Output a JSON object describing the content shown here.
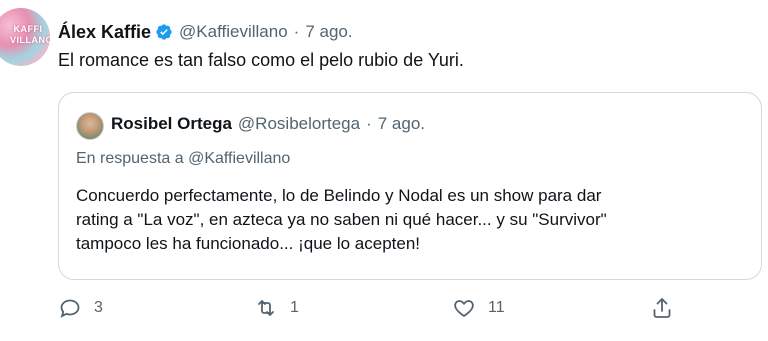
{
  "author": {
    "name": "Álex Kaffie",
    "handle": "@Kaffievillano",
    "separator": "·",
    "date": "7 ago.",
    "avatar_text": "KAFFI VILLANO"
  },
  "tweet": {
    "text": "El romance es tan falso como el pelo rubio de Yuri."
  },
  "quoted": {
    "name": "Rosibel Ortega",
    "handle": "@Rosibelortega",
    "separator": "·",
    "date": "7 ago.",
    "reply_prefix": "En respuesta a",
    "reply_mention": "@Kaffievillano",
    "lines": [
      "Concuerdo perfectamente, lo de Belindo y Nodal es un show para dar",
      "rating a \"La voz\", en azteca ya no saben ni qué hacer... y su \"Survivor\"",
      "tampoco les ha funcionado... ¡que lo acepten!"
    ]
  },
  "actions": {
    "reply_count": "3",
    "retweet_count": "1",
    "like_count": "11"
  },
  "colors": {
    "verified": "#1d9bf0",
    "muted": "#536471",
    "border": "#cfd9de"
  }
}
